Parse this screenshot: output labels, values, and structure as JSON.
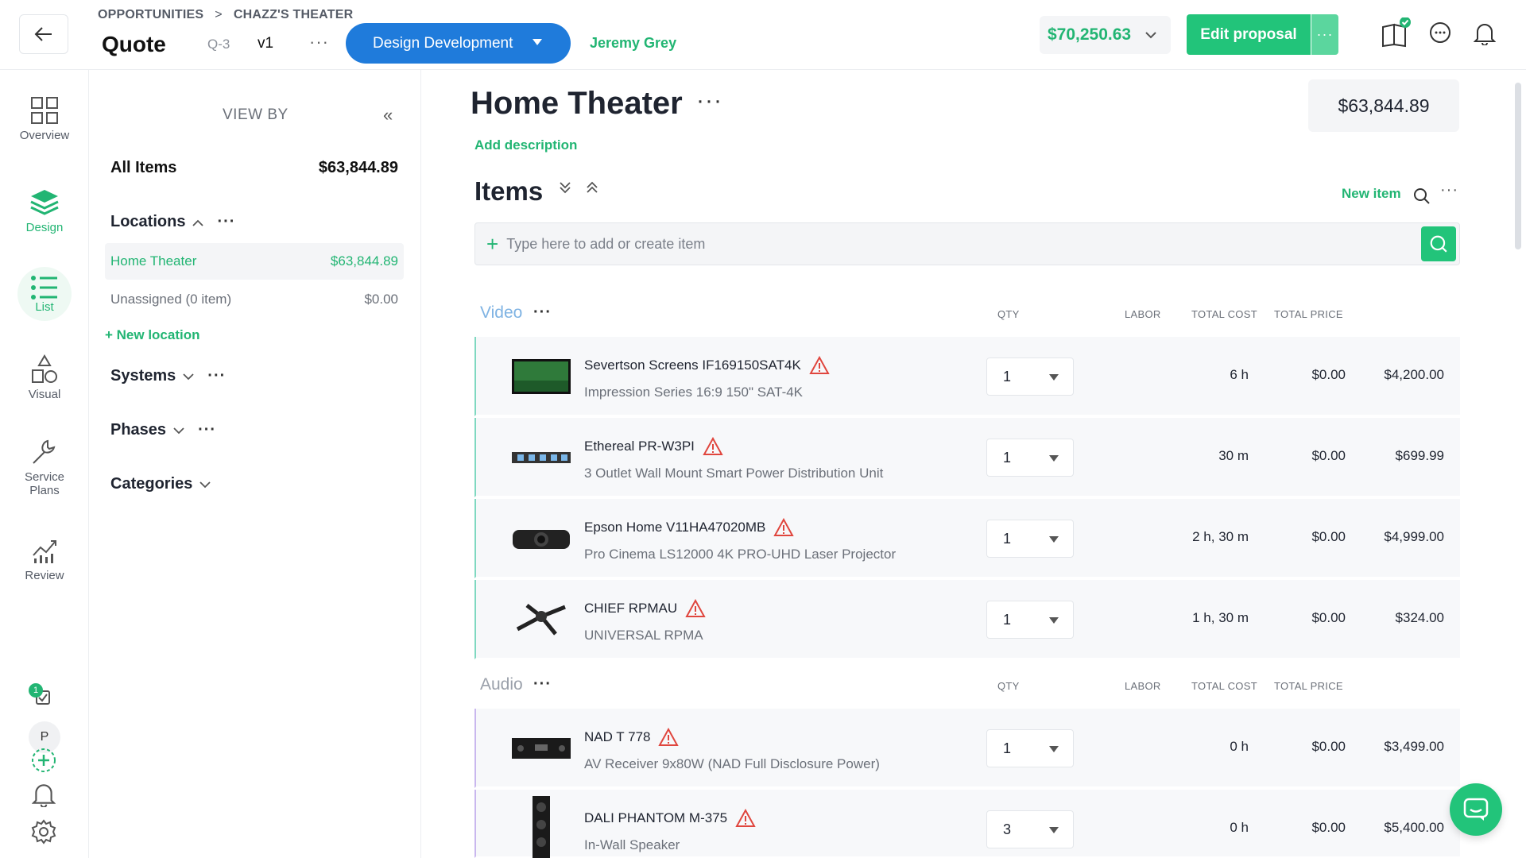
{
  "header": {
    "breadcrumb": [
      "OPPORTUNITIES",
      "CHAZZ'S THEATER"
    ],
    "breadcrumb_sep": ">",
    "title": "Quote",
    "quote_id": "Q-3",
    "version": "v1",
    "phase": "Design Development",
    "owner": "Jeremy Grey",
    "total": "$70,250.63",
    "edit_label": "Edit proposal",
    "more": "···"
  },
  "rail": {
    "items": [
      {
        "label": "Overview",
        "icon": "grid-icon"
      },
      {
        "label": "Design",
        "icon": "layers-icon"
      },
      {
        "label": "List",
        "icon": "list-icon"
      },
      {
        "label": "Visual",
        "icon": "shapes-icon"
      },
      {
        "label": "Service Plans",
        "icon": "wrench-icon"
      },
      {
        "label": "Review",
        "icon": "chart-icon"
      }
    ],
    "tasks_count": "1",
    "avatar_initial": "P"
  },
  "panel": {
    "view_by": "VIEW BY",
    "collapse": "«",
    "all_items_label": "All Items",
    "all_items_total": "$63,844.89",
    "locations_label": "Locations",
    "locations": [
      {
        "name": "Home Theater",
        "total": "$63,844.89",
        "selected": true
      },
      {
        "name": "Unassigned (0 item)",
        "total": "$0.00",
        "selected": false
      }
    ],
    "new_location": "+ New location",
    "systems_label": "Systems",
    "phases_label": "Phases",
    "categories_label": "Categories",
    "dots": "···"
  },
  "main": {
    "location_title": "Home Theater",
    "title_dots": "···",
    "location_total": "$63,844.89",
    "add_description": "Add description",
    "items_title": "Items",
    "expand_all": "⌄",
    "collapse_all": "⌃",
    "new_item": "New item",
    "more": "···",
    "add_placeholder": "Type here to add or create item",
    "columns": {
      "qty": "QTY",
      "labor": "LABOR",
      "total_cost": "TOTAL COST",
      "total_price": "TOTAL PRICE"
    },
    "sections": [
      {
        "name": "Video",
        "items": [
          {
            "name": "Severtson Screens IF169150SAT4K",
            "desc": "Impression Series 16:9 150\" SAT-4K",
            "qty": "1",
            "labor": "6 h",
            "cost": "$0.00",
            "price": "$4,200.00"
          },
          {
            "name": "Ethereal PR-W3PI",
            "desc": "3 Outlet Wall Mount Smart Power Distribution Unit",
            "qty": "1",
            "labor": "30 m",
            "cost": "$0.00",
            "price": "$699.99"
          },
          {
            "name": "Epson Home V11HA47020MB",
            "desc": "Pro Cinema LS12000 4K PRO-UHD Laser Projector",
            "qty": "1",
            "labor": "2 h, 30 m",
            "cost": "$0.00",
            "price": "$4,999.00"
          },
          {
            "name": "CHIEF RPMAU",
            "desc": "UNIVERSAL RPMA",
            "qty": "1",
            "labor": "1 h, 30 m",
            "cost": "$0.00",
            "price": "$324.00"
          }
        ]
      },
      {
        "name": "Audio",
        "items": [
          {
            "name": "NAD T 778",
            "desc": "AV Receiver 9x80W (NAD Full Disclosure Power)",
            "qty": "1",
            "labor": "0 h",
            "cost": "$0.00",
            "price": "$3,499.00"
          },
          {
            "name": "DALI PHANTOM M-375",
            "desc": "In-Wall Speaker",
            "qty": "3",
            "labor": "0 h",
            "cost": "$0.00",
            "price": "$5,400.00"
          }
        ]
      }
    ]
  },
  "colors": {
    "green": "#22b573",
    "blue": "#1f7bdb",
    "video_accent": "#7fd8c0",
    "audio_accent": "#c9b7ee",
    "warning": "#e0463e"
  }
}
